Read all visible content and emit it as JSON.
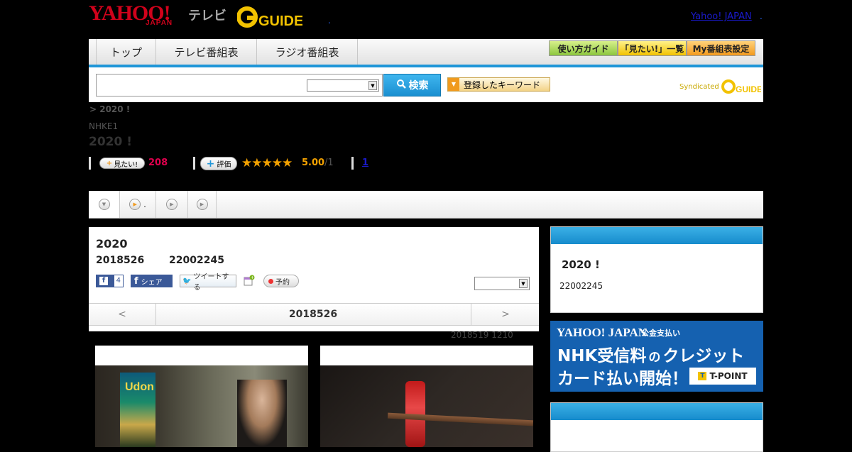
{
  "header": {
    "logo_yahoo": "YAHOO!",
    "logo_japan": "JAPAN",
    "logo_tv": "テレビ",
    "logo_gguide": "G GUIDE",
    "yahoo_japan_link": "Yahoo! JAPAN",
    "separator": "."
  },
  "nav": {
    "tabs": [
      "トップ",
      "テレビ番組表",
      "ラジオ番組表"
    ],
    "buttons": [
      "使い方ガイド",
      "「見たい!」一覧",
      "My番組表設定"
    ]
  },
  "search": {
    "button_label": "検索",
    "keyword_button": "登録したキーワード",
    "syndicated": "Syndicated"
  },
  "program": {
    "breadcrumb": "> 2020 !",
    "channel": "NHKE1",
    "title": "2020 !",
    "mitai_label": "見たい!",
    "mitai_count": "208",
    "rating_label": "評価",
    "stars": "★★★★★",
    "rating_value": "5.00",
    "rating_count": "/1",
    "link_count": "1"
  },
  "tabs": {
    "tab2_text": "."
  },
  "card": {
    "title": "2020",
    "date": "2018526",
    "time": "22002245",
    "fb_count": "4",
    "share_label": "シェア",
    "tweet_label": "ツイートする",
    "reserve_label": "予約",
    "prev_label": "<",
    "date_center": "2018526",
    "next_label": ">",
    "below_note": "2018519  1210"
  },
  "right": {
    "title": "2020 !",
    "time": "22002245"
  },
  "ad": {
    "brand": "YAHOO! JAPAN",
    "tag": "公金支払い",
    "line1_a": "NHK受信料",
    "line1_b": "の",
    "line1_c": "クレジット",
    "line2": "カード払い開始！",
    "tpoint": "T-POINT"
  },
  "colors": {
    "accent_blue": "#1f96d8",
    "brand_red": "#d0021b",
    "count_pink": "#e0004d",
    "rating_orange": "#f4a200",
    "ad_blue": "#1561b0"
  }
}
